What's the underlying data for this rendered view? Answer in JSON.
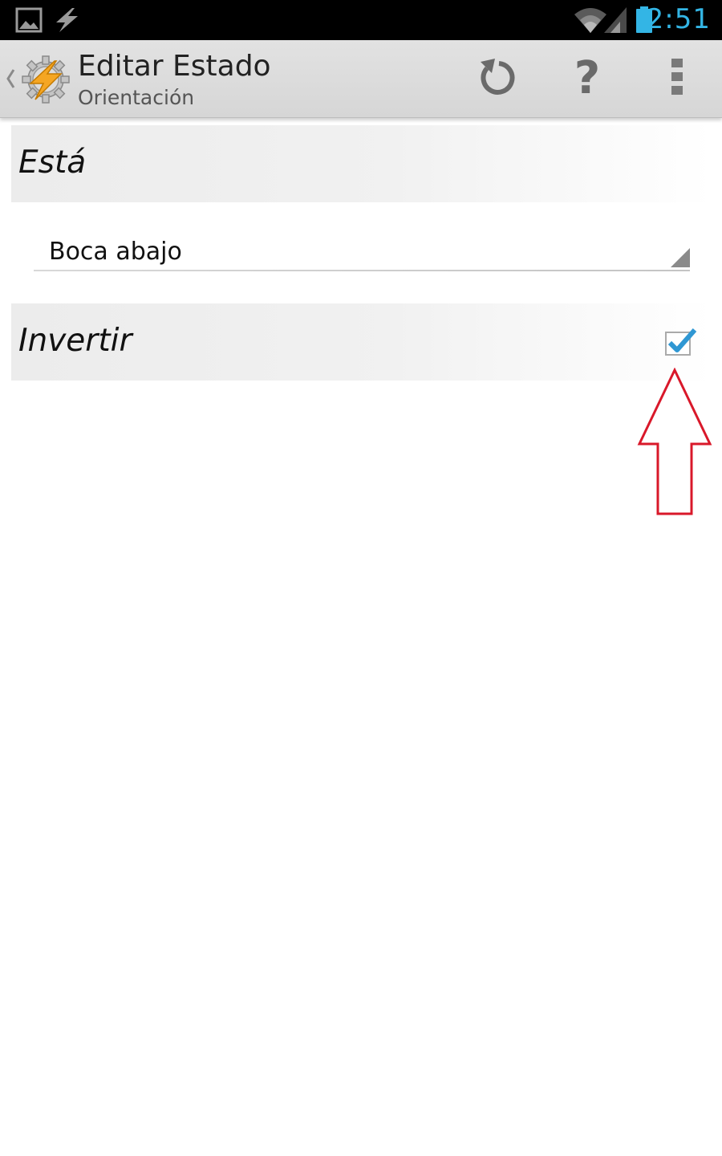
{
  "status_bar": {
    "time": "2:51",
    "icons": [
      "gallery-icon",
      "flash-icon",
      "wifi-icon",
      "signal-icon",
      "battery-icon"
    ]
  },
  "action_bar": {
    "title": "Editar Estado",
    "subtitle": "Orientación",
    "actions": [
      "undo-icon",
      "help-icon",
      "overflow-menu-icon"
    ],
    "help_glyph": "?"
  },
  "form": {
    "section_state_label": "Está",
    "spinner_value": "Boca abajo",
    "section_invert_label": "Invertir",
    "invert_checked": true
  },
  "colors": {
    "accent": "#33b5e5",
    "status_bar_bg": "#000000",
    "action_bar_bg": "#d9d9d9",
    "app_icon_orange": "#f5a623",
    "annotation_arrow": "#d9182a"
  }
}
